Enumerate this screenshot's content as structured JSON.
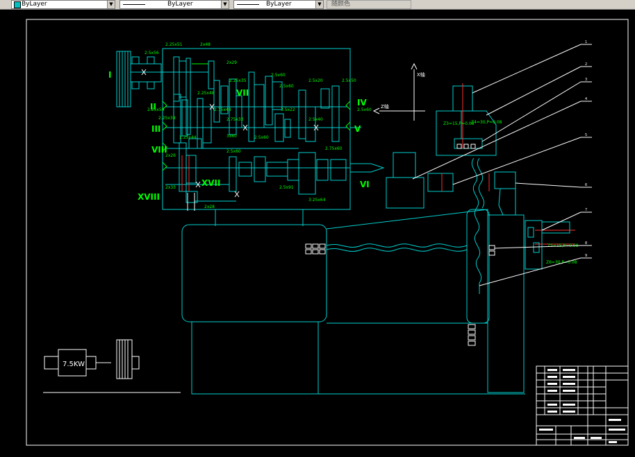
{
  "toolbar": {
    "layer_combo": "ByLayer",
    "linetype_combo": "ByLayer",
    "lineweight_combo": "ByLayer",
    "plotstyle_combo": "随颜色",
    "layer_swatch_color": "#00c0c0"
  },
  "drawing": {
    "background": "#000000",
    "frame_color": "#ffffff",
    "main_color": "#00d0d0",
    "label_color": "#00ff00",
    "axis_color": "#ffffff",
    "center_color": "#ff3030",
    "roman": {
      "I": "I",
      "II": "II",
      "III": "III",
      "IV": "IV",
      "V": "V",
      "VI": "VI",
      "VII": "VII",
      "VIII": "VIII",
      "XVII": "XVII",
      "XVIII": "XVIII"
    },
    "gears": {
      "g1": "2.5x56",
      "g2": "2.25x51",
      "g3": "2x48",
      "g4": "2x29",
      "g5": "2.25x35",
      "g6": "2.5x60",
      "g7": "2.5x20",
      "g8": "2.5x50",
      "g9": "2.25x48",
      "g10": "2.25x59",
      "g11": "2.75x48",
      "g12": "2.25x38",
      "g13": "2.5x60",
      "g14": "3.5x22",
      "g15": "2.5x40",
      "g16": "2.25x44",
      "g17": "2.75x32",
      "g18": "3x60",
      "g19": "2.5x60",
      "g20": "2x26",
      "g21": "2.5x91",
      "g22": "2x33",
      "g23": "2x28",
      "g24": "3.25x64",
      "g25": "2.5x60",
      "g26": "2.75x60",
      "g27": "2.5x60"
    },
    "axis_x": "X轴",
    "axis_z": "Z轴",
    "spindle_upper_label": "Z3=15,P=0.08",
    "spindle_upper_label_2": "Z4=30,P=0.08",
    "spindle_right_label": "Z5=15,P=0.08",
    "spindle_right_label_2": "Z6=30,P=0.08",
    "motor_power": "7.5KW",
    "leaders": [
      "1",
      "2",
      "3",
      "4",
      "5",
      "6",
      "7",
      "8",
      "9"
    ]
  }
}
